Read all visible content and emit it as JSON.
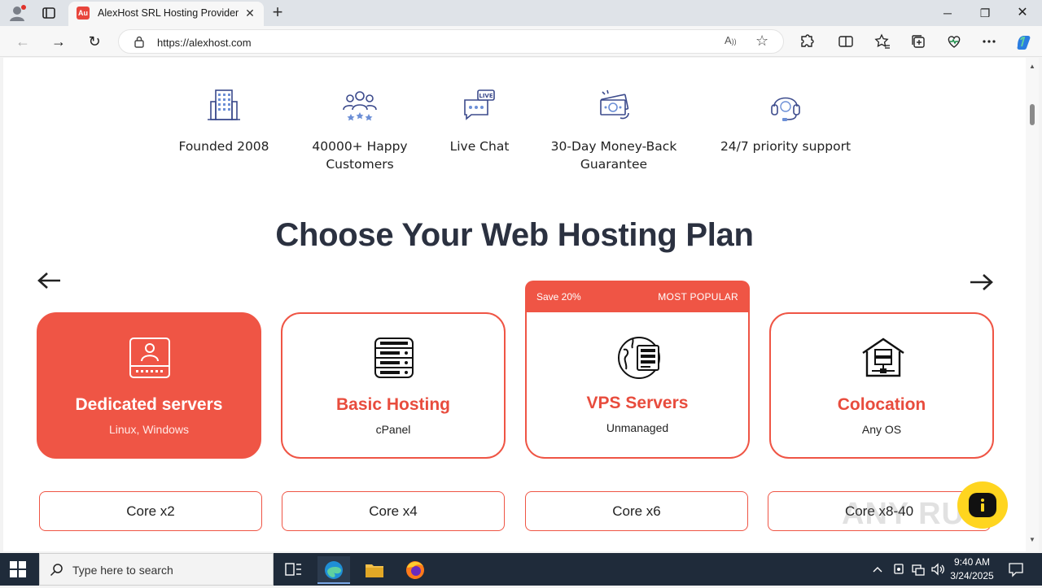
{
  "browser": {
    "tab_title": "AlexHost SRL Hosting Provider -",
    "tab_favicon_text": "Au",
    "url": "https://alexhost.com",
    "read_aloud_label": "A",
    "icons": [
      "profile-icon",
      "tab-actions-icon",
      "close-icon",
      "new-tab-icon",
      "back-icon",
      "forward-icon",
      "reload-icon",
      "lock-icon",
      "read-aloud-icon",
      "favorite-star-icon",
      "extensions-icon",
      "split-screen-icon",
      "favorites-icon",
      "collections-icon",
      "browser-essentials-icon",
      "more-icon",
      "copilot-icon"
    ]
  },
  "features": [
    {
      "label": "Founded 2008",
      "icon": "building-icon"
    },
    {
      "label": "40000+ Happy Customers",
      "icon": "happy-customers-icon"
    },
    {
      "label": "Live Chat",
      "icon": "live-chat-icon"
    },
    {
      "label": "30-Day Money-Back Guarantee",
      "icon": "money-back-icon"
    },
    {
      "label": "24/7 priority support",
      "icon": "headset-icon"
    }
  ],
  "heading": "Choose Your Web Hosting Plan",
  "promo": {
    "save": "Save 20%",
    "badge": "MOST POPULAR"
  },
  "plans": [
    {
      "title": "Dedicated servers",
      "subtitle": "Linux, Windows",
      "icon": "dedicated-server-icon",
      "active": true
    },
    {
      "title": "Basic Hosting",
      "subtitle": "cPanel",
      "icon": "server-rack-icon",
      "active": false
    },
    {
      "title": "VPS Servers",
      "subtitle": "Unmanaged",
      "icon": "vps-globe-icon",
      "active": false
    },
    {
      "title": "Colocation",
      "subtitle": "Any OS",
      "icon": "colocation-icon",
      "active": false
    }
  ],
  "cores": [
    "Core x2",
    "Core x4",
    "Core x6",
    "Core x8-40"
  ],
  "watermark": "ANY RUN",
  "taskbar": {
    "search_placeholder": "Type here to search",
    "time": "9:40 AM",
    "date": "3/24/2025"
  },
  "colors": {
    "accent": "#ef5545",
    "heading": "#2b3140",
    "chat": "#ffd51f",
    "taskbar": "#1f2b3a"
  }
}
